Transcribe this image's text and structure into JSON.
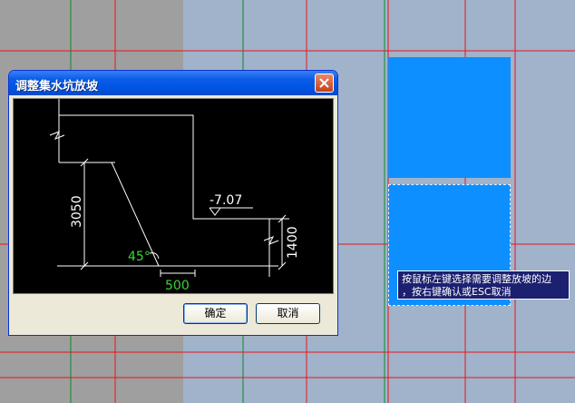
{
  "dialog": {
    "title": "调整集水坑放坡",
    "ok_label": "确定",
    "cancel_label": "取消"
  },
  "diagram": {
    "elevation": "-7.07",
    "depth_left": "3050",
    "depth_right": "1400",
    "angle": "45°",
    "offset": "500"
  },
  "tooltip": {
    "line1": "按鼠标左键选择需要调整放坡的边",
    "line2": "，按右键确认或ESC取消"
  },
  "colors": {
    "grid_line": "#e8141a",
    "axis_line": "#0e8a2a",
    "block_fill": "#0d8fff",
    "dialog_title": "#0054e3"
  }
}
